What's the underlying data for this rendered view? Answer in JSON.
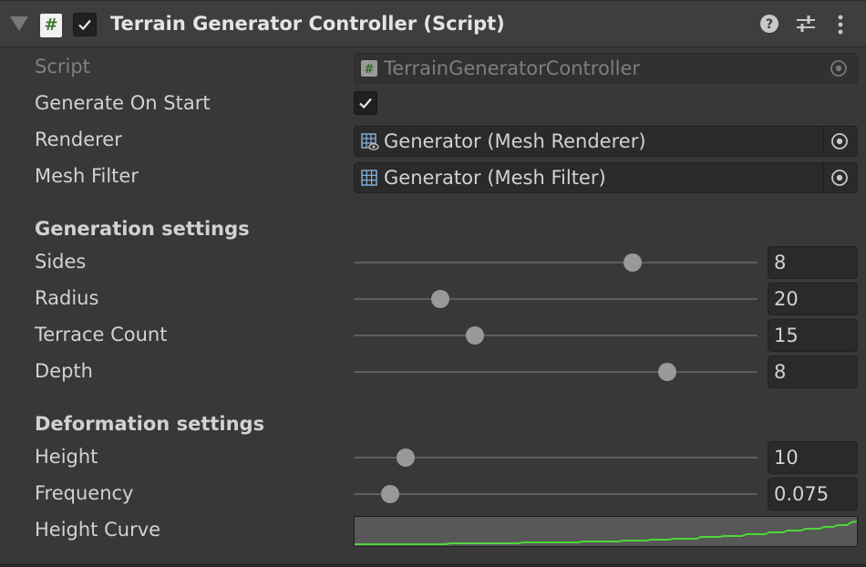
{
  "component": {
    "title": "Terrain Generator Controller (Script)",
    "enabled": true
  },
  "fields": {
    "script": {
      "label": "Script",
      "value": "TerrainGeneratorController"
    },
    "generate_on_start": {
      "label": "Generate On Start",
      "checked": true
    },
    "renderer": {
      "label": "Renderer",
      "value": "Generator (Mesh Renderer)"
    },
    "mesh_filter": {
      "label": "Mesh Filter",
      "value": "Generator (Mesh Filter)"
    }
  },
  "generation": {
    "heading": "Generation settings",
    "sides": {
      "label": "Sides",
      "value": "8",
      "fraction": 0.7
    },
    "radius": {
      "label": "Radius",
      "value": "20",
      "fraction": 0.2
    },
    "terrace_count": {
      "label": "Terrace Count",
      "value": "15",
      "fraction": 0.29
    },
    "depth": {
      "label": "Depth",
      "value": "8",
      "fraction": 0.79
    }
  },
  "deformation": {
    "heading": "Deformation settings",
    "height": {
      "label": "Height",
      "value": "10",
      "fraction": 0.11
    },
    "frequency": {
      "label": "Frequency",
      "value": "0.075",
      "fraction": 0.07
    },
    "height_curve": {
      "label": "Height Curve",
      "curve_color": "#4fd63a"
    }
  },
  "colors": {
    "background": "#383838",
    "field": "#2a2a2a",
    "accent_green": "#4fd63a"
  }
}
